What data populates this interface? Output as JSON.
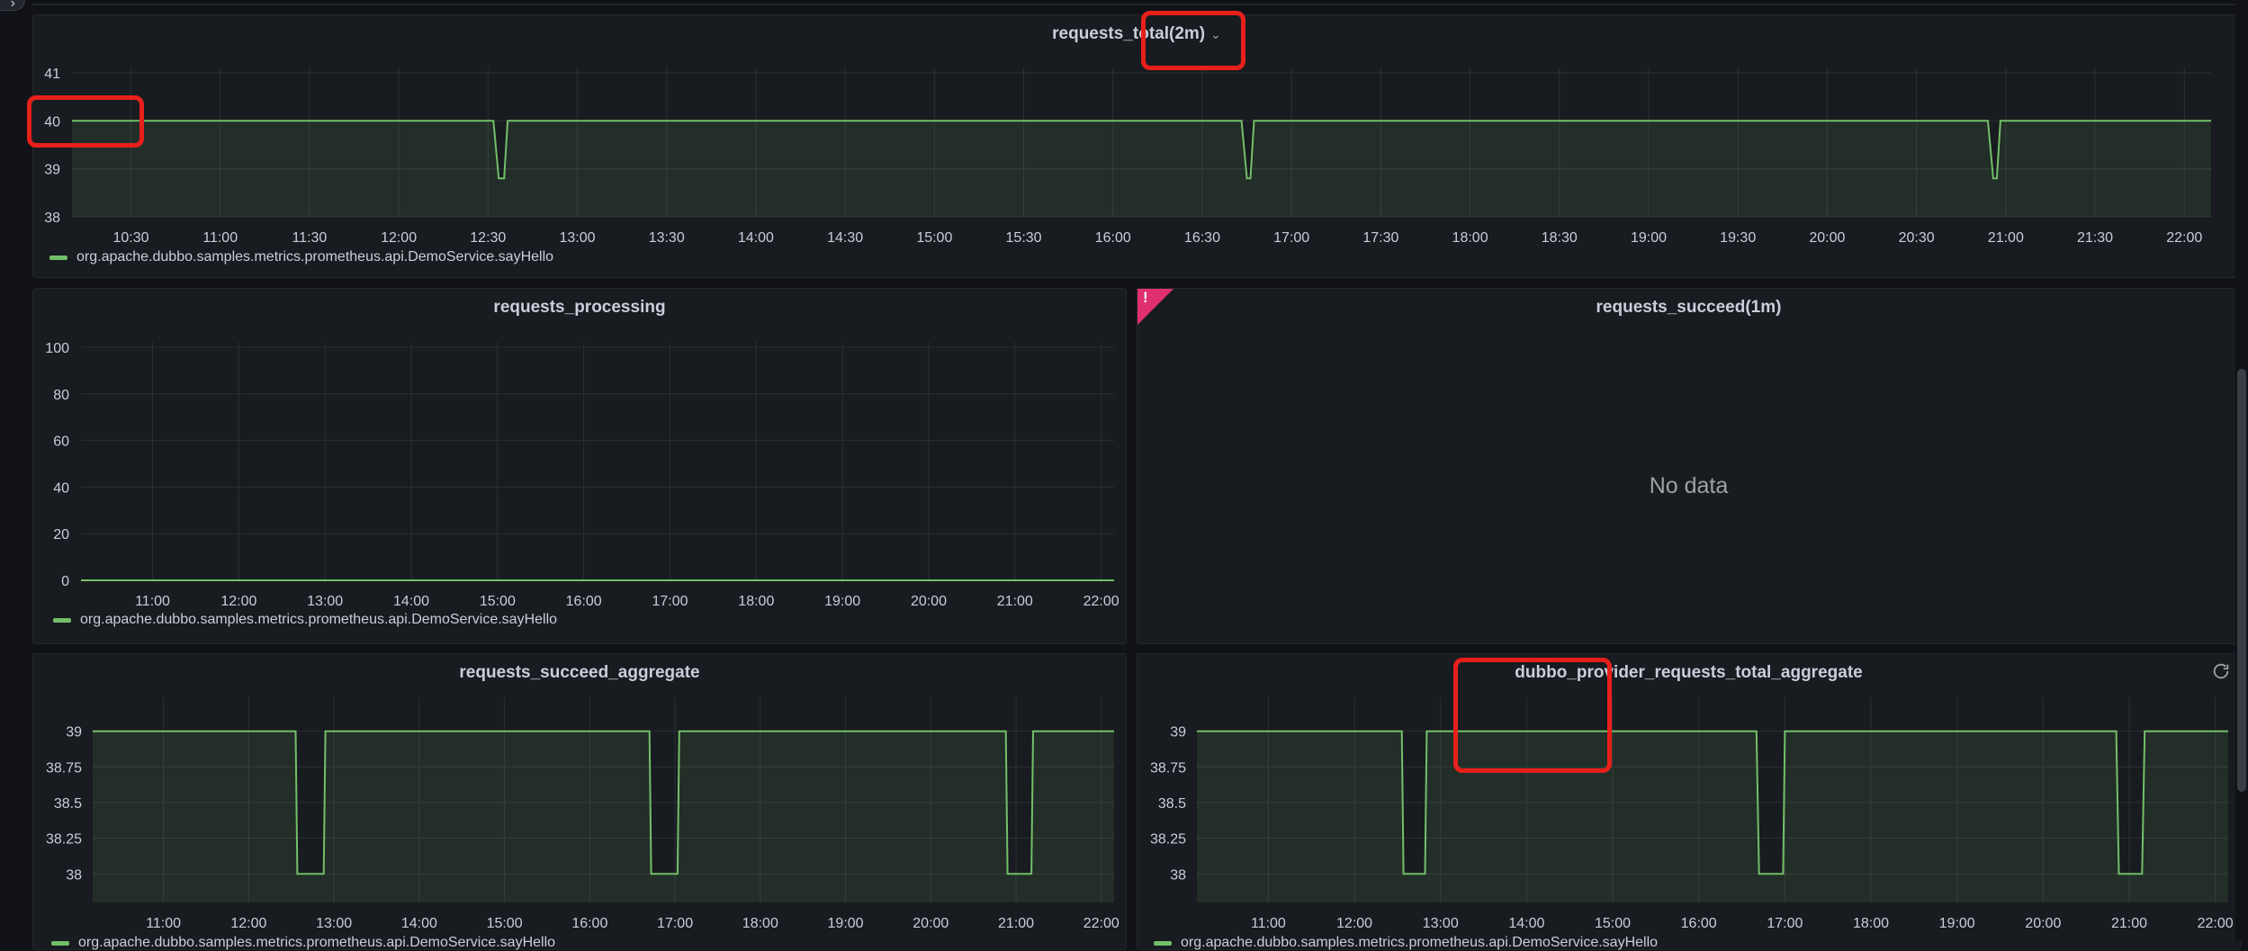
{
  "colors": {
    "series": "#73bf69",
    "grid": "#2c2f35",
    "text": "#ccccdc",
    "panel": "#181b1f",
    "error": "#e02f6e",
    "annotation": "#e8201b"
  },
  "panels": {
    "requests_total": {
      "title": "requests_total(2m)",
      "legend": "org.apache.dubbo.samples.metrics.prometheus.api.DemoService.sayHello"
    },
    "requests_processing": {
      "title": "requests_processing",
      "legend": "org.apache.dubbo.samples.metrics.prometheus.api.DemoService.sayHello"
    },
    "requests_succeed": {
      "title": "requests_succeed(1m)",
      "no_data": "No data",
      "error_icon": "alert-icon"
    },
    "requests_succeed_aggregate": {
      "title": "requests_succeed_aggregate",
      "legend": "org.apache.dubbo.samples.metrics.prometheus.api.DemoService.sayHello"
    },
    "provider_total_aggregate": {
      "title": "dubbo_provider_requests_total_aggregate",
      "legend": "org.apache.dubbo.samples.metrics.prometheus.api.DemoService.sayHello",
      "refresh_icon": "refresh-icon"
    }
  },
  "chart_data": [
    {
      "id": "requests_total",
      "type": "area",
      "title": "requests_total(2m)",
      "y_ticks": [
        "41",
        "40",
        "39",
        "38"
      ],
      "ylim": [
        38,
        41
      ],
      "x_ticks": [
        "10:30",
        "11:00",
        "11:30",
        "12:00",
        "12:30",
        "13:00",
        "13:30",
        "14:00",
        "14:30",
        "15:00",
        "15:30",
        "16:00",
        "16:30",
        "17:00",
        "17:30",
        "18:00",
        "18:30",
        "19:00",
        "19:30",
        "20:00",
        "20:30",
        "21:00",
        "21:30",
        "22:00"
      ],
      "x_hours": [
        10.17,
        22.15
      ],
      "series": [
        {
          "name": "org.apache.dubbo.samples.metrics.prometheus.api.DemoService.sayHello",
          "points": [
            [
              10.17,
              40
            ],
            [
              12.53,
              40
            ],
            [
              12.56,
              38.8
            ],
            [
              12.59,
              38.8
            ],
            [
              12.61,
              40
            ],
            [
              16.72,
              40
            ],
            [
              16.75,
              38.8
            ],
            [
              16.77,
              38.8
            ],
            [
              16.79,
              40
            ],
            [
              20.9,
              40
            ],
            [
              20.93,
              38.8
            ],
            [
              20.95,
              38.8
            ],
            [
              20.97,
              40
            ],
            [
              22.15,
              40
            ]
          ]
        }
      ]
    },
    {
      "id": "requests_processing",
      "type": "area",
      "title": "requests_processing",
      "y_ticks": [
        "100",
        "80",
        "60",
        "40",
        "20",
        "0"
      ],
      "ylim": [
        0,
        100
      ],
      "x_ticks": [
        "11:00",
        "12:00",
        "13:00",
        "14:00",
        "15:00",
        "16:00",
        "17:00",
        "18:00",
        "19:00",
        "20:00",
        "21:00",
        "22:00"
      ],
      "x_hours": [
        10.17,
        22.15
      ],
      "series": [
        {
          "name": "org.apache.dubbo.samples.metrics.prometheus.api.DemoService.sayHello",
          "points": [
            [
              10.17,
              0
            ],
            [
              22.15,
              0
            ]
          ]
        }
      ]
    },
    {
      "id": "requests_succeed_aggregate",
      "type": "area",
      "title": "requests_succeed_aggregate",
      "y_ticks": [
        "39",
        "38.75",
        "38.5",
        "38.25",
        "38"
      ],
      "ylim": [
        37.8,
        39.2
      ],
      "x_ticks": [
        "11:00",
        "12:00",
        "13:00",
        "14:00",
        "15:00",
        "16:00",
        "17:00",
        "18:00",
        "19:00",
        "20:00",
        "21:00",
        "22:00"
      ],
      "x_hours": [
        10.17,
        22.15
      ],
      "series": [
        {
          "name": "org.apache.dubbo.samples.metrics.prometheus.api.DemoService.sayHello",
          "points": [
            [
              10.17,
              39
            ],
            [
              12.55,
              39
            ],
            [
              12.57,
              38
            ],
            [
              12.88,
              38
            ],
            [
              12.9,
              39
            ],
            [
              16.7,
              39
            ],
            [
              16.72,
              38
            ],
            [
              17.03,
              38
            ],
            [
              17.05,
              39
            ],
            [
              20.88,
              39
            ],
            [
              20.9,
              38
            ],
            [
              21.18,
              38
            ],
            [
              21.2,
              39
            ],
            [
              22.15,
              39
            ]
          ]
        }
      ]
    },
    {
      "id": "provider_total_aggregate",
      "type": "area",
      "title": "dubbo_provider_requests_total_aggregate",
      "y_ticks": [
        "39",
        "38.75",
        "38.5",
        "38.25",
        "38"
      ],
      "ylim": [
        37.8,
        39.2
      ],
      "x_ticks": [
        "11:00",
        "12:00",
        "13:00",
        "14:00",
        "15:00",
        "16:00",
        "17:00",
        "18:00",
        "19:00",
        "20:00",
        "21:00",
        "22:00"
      ],
      "x_hours": [
        10.17,
        22.15
      ],
      "series": [
        {
          "name": "org.apache.dubbo.samples.metrics.prometheus.api.DemoService.sayHello",
          "points": [
            [
              10.17,
              39
            ],
            [
              12.55,
              39
            ],
            [
              12.57,
              38
            ],
            [
              12.82,
              38
            ],
            [
              12.84,
              39
            ],
            [
              16.67,
              39
            ],
            [
              16.7,
              38
            ],
            [
              16.98,
              38
            ],
            [
              17.0,
              39
            ],
            [
              20.85,
              39
            ],
            [
              20.88,
              38
            ],
            [
              21.15,
              38
            ],
            [
              21.18,
              39
            ],
            [
              22.15,
              39
            ]
          ]
        }
      ]
    }
  ]
}
